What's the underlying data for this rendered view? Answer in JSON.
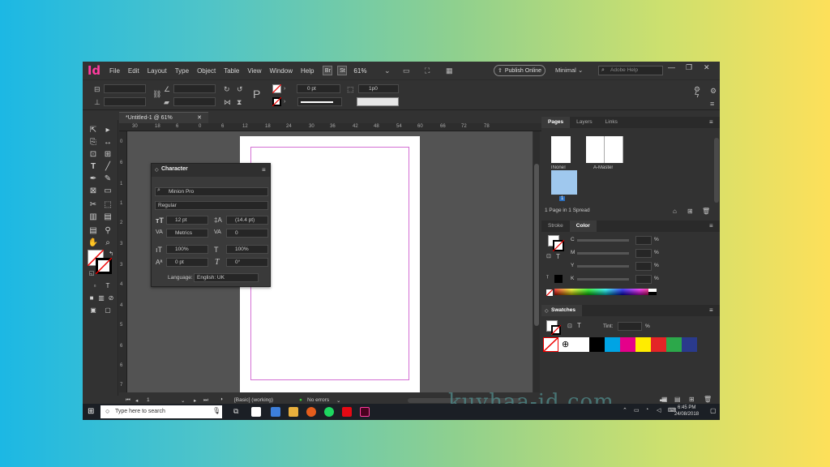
{
  "app": {
    "logo": "Id"
  },
  "menu": [
    "File",
    "Edit",
    "Layout",
    "Type",
    "Object",
    "Table",
    "View",
    "Window",
    "Help"
  ],
  "menubar": {
    "br": "Br",
    "st": "St",
    "zoom": "61%",
    "publish": "Publish Online",
    "workspace": "Minimal",
    "search_placeholder": "Adobe Help"
  },
  "control": {
    "stroke_weight": "0 pt",
    "offset": "1p0"
  },
  "doc": {
    "tab": "*Untitled-1 @ 61%"
  },
  "ruler": {
    "h": [
      "30",
      "18",
      "6",
      "0",
      "6",
      "12",
      "18",
      "24",
      "30",
      "36",
      "42",
      "48",
      "54",
      "60",
      "66",
      "72",
      "78"
    ],
    "v": [
      "0",
      "6",
      "1",
      "1",
      "2",
      "3",
      "3",
      "4",
      "4",
      "5",
      "6",
      "6",
      "7"
    ]
  },
  "character": {
    "title": "Character",
    "font": "Minion Pro",
    "style": "Regular",
    "size": "12 pt",
    "leading": "(14.4 pt)",
    "kerning": "Metrics",
    "tracking": "0",
    "vscale": "100%",
    "hscale": "100%",
    "baseline": "0 pt",
    "skew": "0°",
    "language_label": "Language:",
    "language": "English: UK"
  },
  "pages": {
    "tabs": [
      "Pages",
      "Layers",
      "Links"
    ],
    "none": "[None]",
    "master": "A-Master",
    "page_num": "1",
    "footer": "1 Page in 1 Spread"
  },
  "color": {
    "tabs": [
      "Stroke",
      "Color"
    ],
    "channels": [
      "C",
      "M",
      "Y",
      "K"
    ],
    "pct": "%"
  },
  "swatches": {
    "title": "Swatches",
    "tint_label": "Tint:",
    "pct": "%"
  },
  "status": {
    "page": "1",
    "style": "[Basic] (working)",
    "errors": "No errors"
  },
  "taskbar": {
    "search": "Type here to search",
    "time": "6:45 PM",
    "date": "24/08/2018"
  },
  "watermark": "kuyhaa-id.com",
  "colors": {
    "accent": "#ff3b9e",
    "app_bg": "#323232",
    "canvas": "#535353",
    "margin": "#d470d4"
  }
}
